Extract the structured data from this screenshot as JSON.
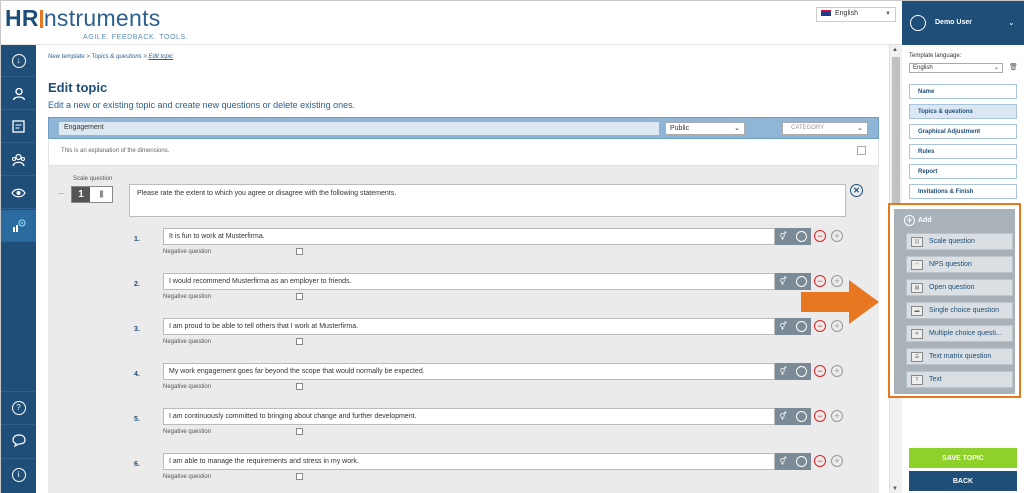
{
  "header": {
    "logo_hr": "HR",
    "logo_instruments": "nstruments",
    "tagline": "AGILE. FEEDBACK. TOOLS.",
    "language": "English"
  },
  "user": {
    "name": "Demo User"
  },
  "breadcrumb": {
    "trail": "New template > Topics & questions > ",
    "current": "Edit topic"
  },
  "page": {
    "title": "Edit topic",
    "subtitle": "Edit a new or existing topic and create new questions or delete existing ones."
  },
  "topic": {
    "name": "Engagement",
    "visibility": "Public",
    "category_placeholder": "CATEGORY",
    "explanation": "This is an explanation of the dimensions."
  },
  "question": {
    "type_label": "Scale question",
    "scale_number": "1",
    "text": "Please rate the extent to which you agree or disagree with the following statements."
  },
  "statements": [
    {
      "num": "1.",
      "text": "It is fun to work at Musterfirma.",
      "neg_label": "Negative question"
    },
    {
      "num": "2.",
      "text": "I would recommend Musterfirma as an employer to friends.",
      "neg_label": "Negative question"
    },
    {
      "num": "3.",
      "text": "I am proud to be able to tell others that I work at Musterfirma.",
      "neg_label": "Negative question"
    },
    {
      "num": "4.",
      "text": "My work engagement goes far beyond the scope that would normally be expected.",
      "neg_label": "Negative question"
    },
    {
      "num": "5.",
      "text": "I am continuously committed to bringing about change and further development.",
      "neg_label": "Negative question"
    },
    {
      "num": "6.",
      "text": "I am able to manage the requirements and stress in my work.",
      "neg_label": "Negative question"
    }
  ],
  "right_panel": {
    "template_language_label": "Template language:",
    "template_language": "English",
    "steps": [
      "Name",
      "Topics & questions",
      "Graphical Adjustment",
      "Rules",
      "Report",
      "Invitations & Finish"
    ],
    "add_label": "Add",
    "add_items": [
      "Scale question",
      "NPS question",
      "Open question",
      "Single choice question",
      "Multiple choice questi...",
      "Text matrix question",
      "Text"
    ],
    "save_label": "SAVE TOPIC",
    "back_label": "BACK"
  },
  "colors": {
    "brand_blue": "#1f4e79",
    "highlight_orange": "#e87722",
    "save_green": "#8ed12b"
  }
}
